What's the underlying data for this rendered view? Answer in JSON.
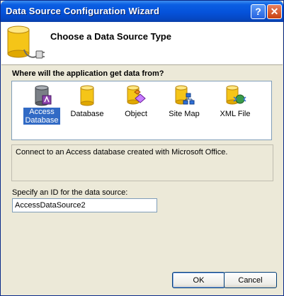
{
  "window": {
    "title": "Data Source Configuration Wizard",
    "help_glyph": "?",
    "close_glyph": "✕"
  },
  "header": {
    "title": "Choose a Data Source Type",
    "icon": "database-plug-icon"
  },
  "prompt": "Where will the application get data from?",
  "sources": [
    {
      "label_line1": "Access",
      "label_line2": "Database",
      "icon": "access-database-icon",
      "selected": true
    },
    {
      "label_line1": "Database",
      "label_line2": "",
      "icon": "database-icon",
      "selected": false
    },
    {
      "label_line1": "Object",
      "label_line2": "",
      "icon": "object-icon",
      "selected": false
    },
    {
      "label_line1": "Site Map",
      "label_line2": "",
      "icon": "site-map-icon",
      "selected": false
    },
    {
      "label_line1": "XML File",
      "label_line2": "",
      "icon": "xml-file-icon",
      "selected": false
    }
  ],
  "description": "Connect to an Access database created with Microsoft Office.",
  "id_field": {
    "label": "Specify an ID for the data source:",
    "value": "AccessDataSource2"
  },
  "buttons": {
    "ok": "OK",
    "cancel": "Cancel"
  },
  "colors": {
    "title_bar": "#0552da",
    "selection": "#316ac5",
    "dialog_face": "#ece9d8",
    "cylinder_yellow": "#f5c518"
  }
}
